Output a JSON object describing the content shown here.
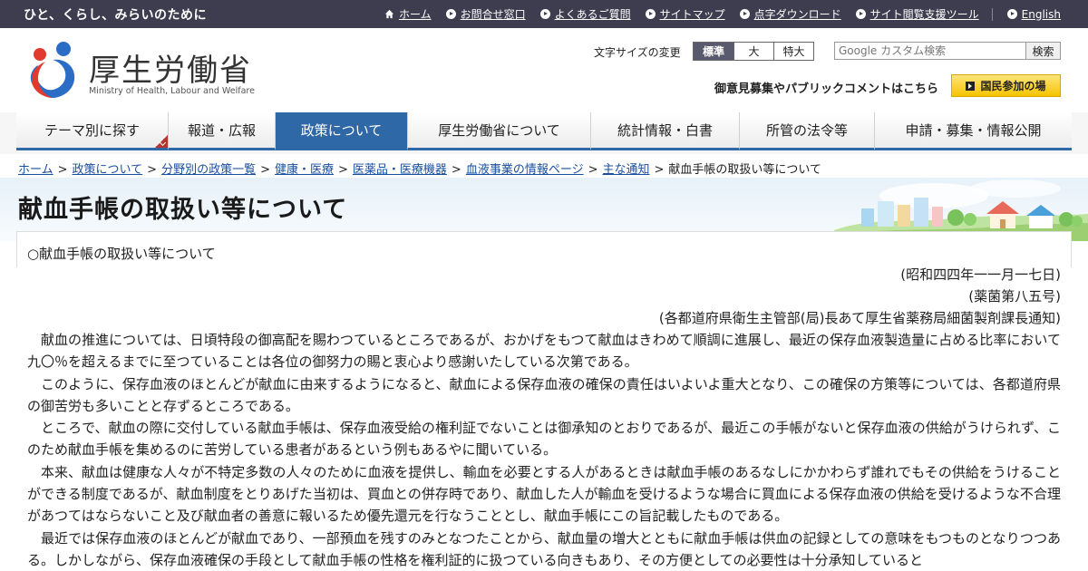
{
  "topbar": {
    "tagline": "ひと、くらし、みらいのために",
    "links": [
      {
        "label": "ホーム",
        "icon": "home-icon"
      },
      {
        "label": "お問合せ窓口",
        "icon": "arrow-circle-icon"
      },
      {
        "label": "よくあるご質問",
        "icon": "arrow-circle-icon"
      },
      {
        "label": "サイトマップ",
        "icon": "arrow-circle-icon"
      },
      {
        "label": "点字ダウンロード",
        "icon": "arrow-circle-icon"
      },
      {
        "label": "サイト閲覧支援ツール",
        "icon": "arrow-circle-icon"
      },
      {
        "label": "English",
        "icon": "arrow-circle-icon"
      }
    ]
  },
  "header": {
    "logo_text": "厚生労働省",
    "logo_subtext": "Ministry of Health, Labour and Welfare",
    "font_size_label": "文字サイズの変更",
    "font_sizes": [
      "標準",
      "大",
      "特大"
    ],
    "search_placeholder": "Google カスタム検索",
    "search_button": "検索",
    "public_comment": "御意見募集やパブリックコメントはこちら",
    "kokumin_button": "国民参加の場"
  },
  "nav": [
    {
      "label": "テーマ別に探す",
      "active": false
    },
    {
      "label": "報道・広報",
      "active": false
    },
    {
      "label": "政策について",
      "active": true
    },
    {
      "label": "厚生労働省について",
      "active": false
    },
    {
      "label": "統計情報・白書",
      "active": false
    },
    {
      "label": "所管の法令等",
      "active": false
    },
    {
      "label": "申請・募集・情報公開",
      "active": false
    }
  ],
  "breadcrumb": {
    "links": [
      "ホーム",
      "政策について",
      "分野別の政策一覧",
      "健康・医療",
      "医薬品・医療機器",
      "血液事業の情報ページ",
      "主な通知"
    ],
    "current": "献血手帳の取扱い等について"
  },
  "page": {
    "title": "献血手帳の取扱い等について",
    "heading": "○献血手帳の取扱い等について",
    "date": "(昭和四四年一一月一七日)",
    "number": "(薬菌第八五号)",
    "addressee": "(各都道府県衛生主管部(局)長あて厚生省薬務局細菌製剤課長通知)",
    "paragraphs": [
      "献血の推進については、日頃特段の御高配を賜わつているところであるが、おかげをもつて献血はきわめて順調に進展し、最近の保存血液製造量に占める比率において九〇％を超えるまでに至つていることは各位の御努力の賜と衷心より感謝いたしている次第である。",
      "このように、保存血液のほとんどが献血に由来するようになると、献血による保存血液の確保の責任はいよいよ重大となり、この確保の方策等については、各都道府県の御苦労も多いことと存ずるところである。",
      "ところで、献血の際に交付している献血手帳は、保存血液受給の権利証でないことは御承知のとおりであるが、最近この手帳がないと保存血液の供給がうけられず、このため献血手帳を集めるのに苦労している患者があるという例もあるやに聞いている。",
      "本来、献血は健康な人々が不特定多数の人々のために血液を提供し、輸血を必要とする人があるときは献血手帳のあるなしにかかわらず誰れでもその供給をうけることができる制度であるが、献血制度をとりあげた当初は、買血との併存時であり、献血した人が輸血を受けるような場合に買血による保存血液の供給を受けるような不合理があつてはならないこと及び献血者の善意に報いるため優先還元を行なうこととし、献血手帳にこの旨記載したものである。",
      "最近では保存血液のほとんどが献血であり、一部預血を残すのみとなつたことから、献血量の増大とともに献血手帳は供血の記録としての意味をもつものとなりつつある。しかしながら、保存血液確保の手段として献血手帳の性格を権利証的に扱つている向きもあり、その方便としての必要性は十分承知していると"
    ]
  }
}
